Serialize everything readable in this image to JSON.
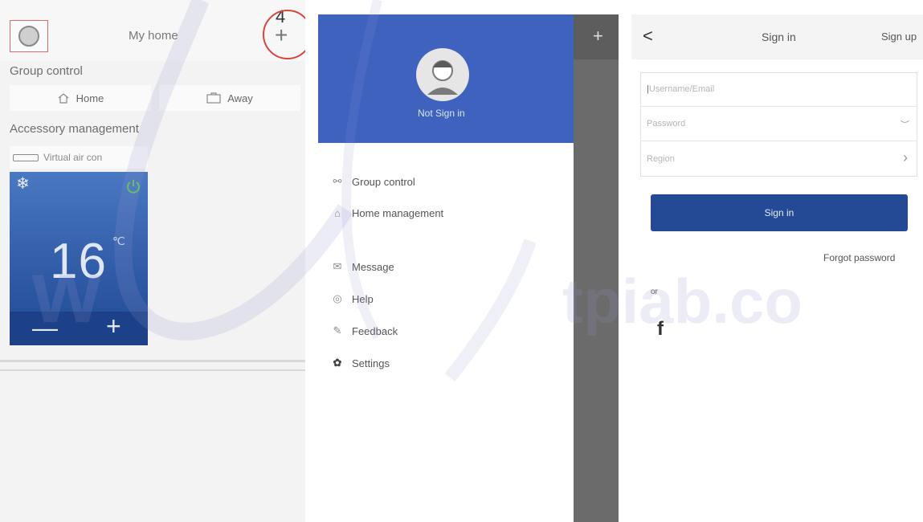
{
  "panel_home": {
    "title": "My home",
    "step_number": "4",
    "group_control_heading": "Group control",
    "home_button": "Home",
    "away_button": "Away",
    "accessory_heading": "Accessory management",
    "device_name": "Virtual air con",
    "temperature": "16",
    "unit": "℃",
    "minus": "—",
    "plus": "+"
  },
  "panel_menu": {
    "user_status": "Not Sign in",
    "items": [
      {
        "label": "Group control",
        "icon": "group-icon"
      },
      {
        "label": "Home management",
        "icon": "home-icon"
      },
      {
        "label": "Message",
        "icon": "message-icon"
      },
      {
        "label": "Help",
        "icon": "help-icon"
      },
      {
        "label": "Feedback",
        "icon": "feedback-icon"
      },
      {
        "label": "Settings",
        "icon": "settings-icon"
      }
    ]
  },
  "panel_signin": {
    "back": "<",
    "title": "Sign in",
    "signup": "Sign up",
    "username_placeholder": "Username/Email",
    "password_placeholder": "Password",
    "region_placeholder": "Region",
    "signin_button": "Sign in",
    "forgot": "Forgot password",
    "or": "or",
    "facebook": "f"
  },
  "watermark": {
    "left": "w",
    "right": "tpiab.co"
  },
  "colors": {
    "accent_blue": "#3e62be",
    "button_blue": "#244a96",
    "power_green": "#5cc94a",
    "annotation_red": "#d9453b"
  }
}
